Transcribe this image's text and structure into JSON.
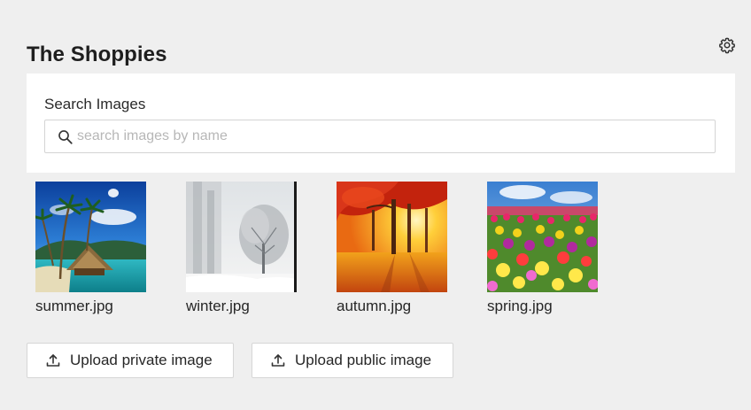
{
  "header": {
    "title": "The Shoppies",
    "settings_icon": "gear-icon"
  },
  "search": {
    "label": "Search Images",
    "placeholder": "search images by name",
    "value": "",
    "icon": "search-icon"
  },
  "gallery": {
    "images": [
      {
        "filename": "summer.jpg",
        "scene": "tropical beach with palm trees and hut"
      },
      {
        "filename": "winter.jpg",
        "scene": "snowy trees in winter"
      },
      {
        "filename": "autumn.jpg",
        "scene": "sunlit autumn forest with red leaves"
      },
      {
        "filename": "spring.jpg",
        "scene": "field of colorful tulips under blue sky"
      }
    ]
  },
  "actions": {
    "upload_private_label": "Upload private image",
    "upload_public_label": "Upload public image",
    "upload_icon": "upload-icon"
  },
  "colors": {
    "background": "#efefef",
    "panel": "#ffffff",
    "border": "#d4d4d4",
    "text": "#222222",
    "placeholder": "#b7b7b7"
  }
}
